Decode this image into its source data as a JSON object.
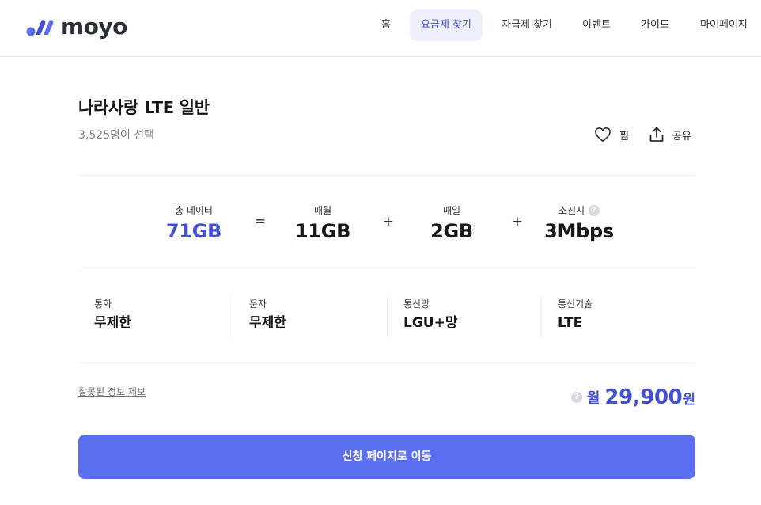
{
  "header": {
    "logo_text": "moyo",
    "nav": [
      "홈",
      "요금제 찾기",
      "자급제 찾기",
      "이벤트",
      "가이드",
      "마이페이지"
    ],
    "active_nav": "요금제 찾기"
  },
  "plan": {
    "title": "나라사랑 LTE 일반",
    "selected_count": "3,525명이 선택",
    "like_label": "찜",
    "share_label": "공유"
  },
  "data_summary": {
    "total": {
      "label": "총 데이터",
      "value": "71GB"
    },
    "op1": "=",
    "monthly": {
      "label": "매월",
      "value": "11GB"
    },
    "op2": "+",
    "daily": {
      "label": "매일",
      "value": "2GB"
    },
    "op3": "+",
    "after": {
      "label": "소진시",
      "value": "3Mbps"
    }
  },
  "specs": [
    {
      "label": "통화",
      "value": "무제한"
    },
    {
      "label": "문자",
      "value": "무제한"
    },
    {
      "label": "통신망",
      "value": "LGU+망"
    },
    {
      "label": "통신기술",
      "value": "LTE"
    }
  ],
  "report_link": "잘못된 정보 제보",
  "price": {
    "prefix": "월",
    "amount": "29,900",
    "suffix": "원"
  },
  "cta_label": "신청 페이지로 이동",
  "colors": {
    "accent": "#4350d6",
    "cta": "#5b6ef0",
    "nav_active_bg": "#eef1fd"
  },
  "icons": {
    "info": "question-circle-icon",
    "like": "heart-icon",
    "share": "share-icon"
  }
}
